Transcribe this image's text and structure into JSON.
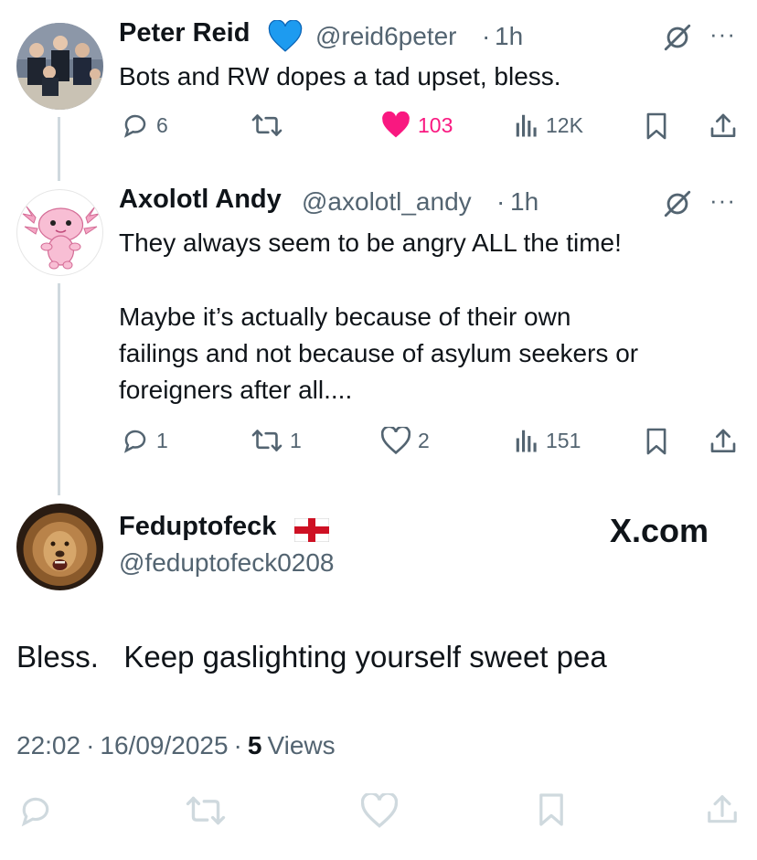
{
  "tweets": [
    {
      "name": "Peter Reid",
      "handle": "@reid6peter",
      "sep": "·",
      "time": "1h",
      "text": "Bots and RW dopes a tad upset, bless.",
      "replies": "6",
      "retweets": "",
      "likes": "103",
      "views": "12K",
      "liked": true
    },
    {
      "name": "Axolotl Andy",
      "handle": "@axolotl_andy",
      "sep": "·",
      "time": "1h",
      "text_line1": "They always seem to be angry ALL the time!",
      "text_line2": "Maybe it’s actually because of their own",
      "text_line3": "failings and not because of asylum seekers or",
      "text_line4": "foreigners after all....",
      "replies": "1",
      "retweets": "1",
      "likes": "2",
      "views": "151",
      "liked": false
    }
  ],
  "main_post": {
    "name": "Feduptofeck",
    "handle": "@feduptofeck0208",
    "text": "Bless.   Keep gaslighting yourself sweet pea",
    "time": "22:02",
    "date": "16/09/2025",
    "views_count": "5",
    "views_label": "Views",
    "sep": "·"
  },
  "watermark": "X.com",
  "more_label": "···",
  "colors": {
    "like_pink": "#f91880",
    "muted": "#536471",
    "faded_action": "#cfd9de",
    "verified_blue": "#1d9bf0"
  },
  "icons": [
    "reply-icon",
    "retweet-icon",
    "heart-icon",
    "views-icon",
    "bookmark-icon",
    "share-icon",
    "grok-icon",
    "more-icon",
    "verified-heart-icon",
    "england-flag-icon"
  ]
}
